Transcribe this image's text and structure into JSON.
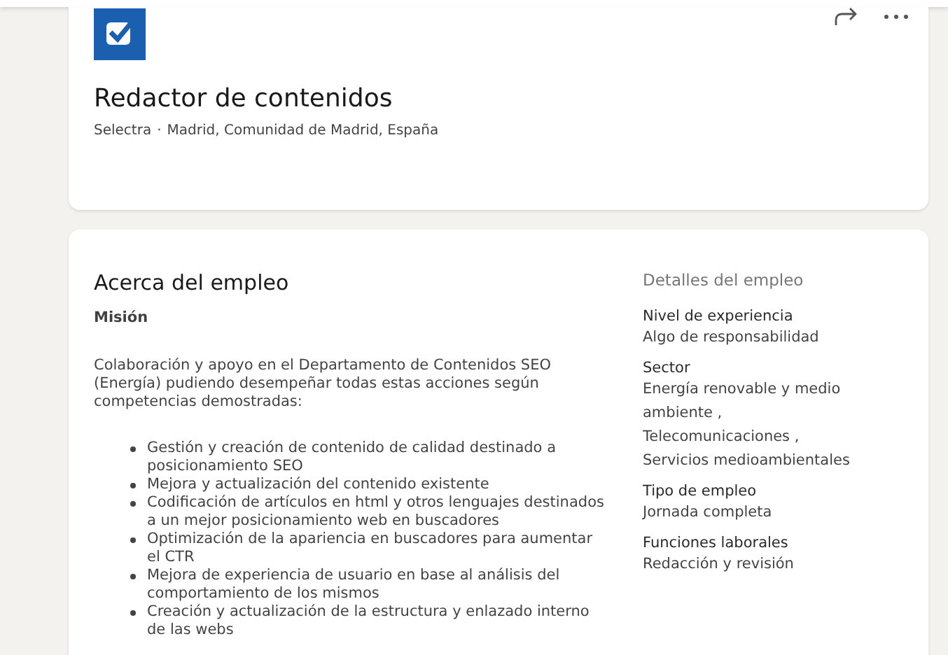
{
  "header": {
    "title": "Redactor de contenidos",
    "company": "Selectra",
    "separator": "·",
    "location": "Madrid, Comunidad de Madrid, España"
  },
  "about": {
    "title": "Acerca del empleo",
    "subtitle": "Misión",
    "intro": "Colaboración y apoyo en el Departamento de Contenidos SEO (Energía) pudiendo desempeñar todas estas acciones según competencias demostradas:",
    "bullets": [
      "Gestión y creación de contenido de calidad destinado a posicionamiento SEO",
      "Mejora y actualización del contenido existente",
      "Codificación de artículos en html y otros lenguajes destinados a un mejor posicionamiento web en buscadores",
      "Optimización de la apariencia en buscadores para aumentar el CTR",
      "Mejora de experiencia de usuario en base al análisis del comportamiento de los mismos",
      "Creación y actualización de la estructura y enlazado interno de las webs"
    ]
  },
  "details": {
    "title": "Detalles del empleo",
    "items": [
      {
        "label": "Nivel de experiencia",
        "values": [
          "Algo de responsabilidad"
        ]
      },
      {
        "label": "Sector",
        "values": [
          "Energía renovable y medio ambiente ,",
          "Telecomunicaciones ,",
          "Servicios medioambientales"
        ]
      },
      {
        "label": "Tipo de empleo",
        "values": [
          "Jornada completa"
        ]
      },
      {
        "label": "Funciones laborales",
        "values": [
          "Redacción y revisión"
        ]
      }
    ]
  }
}
